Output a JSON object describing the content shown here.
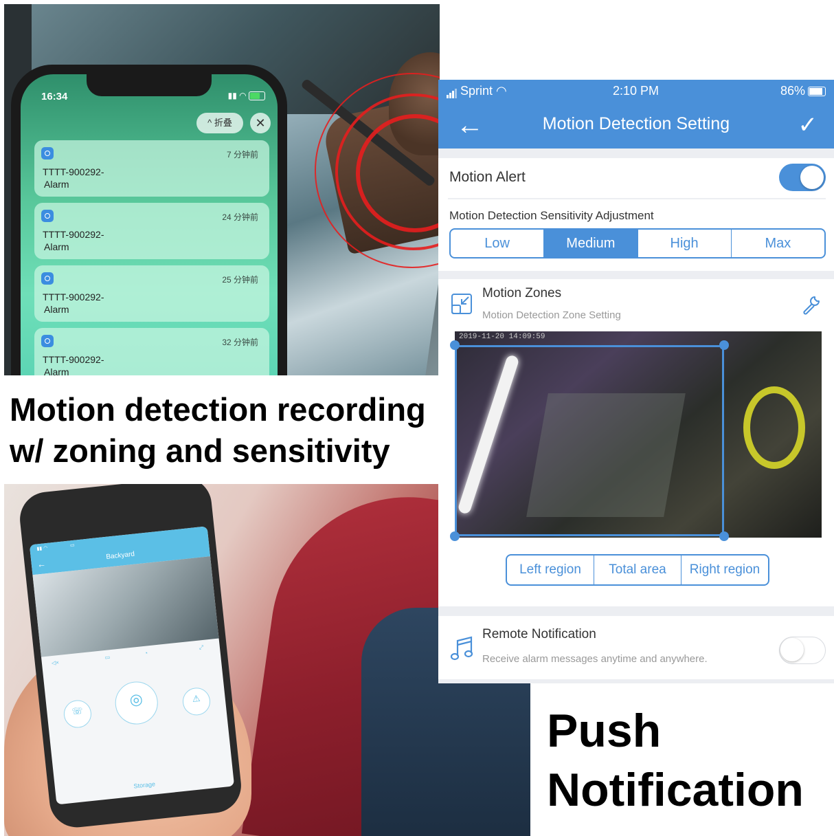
{
  "headline": {
    "line1": "Motion detection recording",
    "line2": "w/ zoning and sensitivity"
  },
  "push_notification": {
    "line1": "Push",
    "line2": "Notification"
  },
  "lock_screen": {
    "time": "16:34",
    "collapse_label": "折叠",
    "close_glyph": "✕",
    "notifications": [
      {
        "time": "7 分钟前",
        "title": "TTTT-900292-",
        "body": "Alarm"
      },
      {
        "time": "24 分钟前",
        "title": "TTTT-900292-",
        "body": "Alarm"
      },
      {
        "time": "25 分钟前",
        "title": "TTTT-900292-",
        "body": "Alarm"
      },
      {
        "time": "32 分钟前",
        "title": "TTTT-900292-",
        "body": "Alarm"
      }
    ]
  },
  "small_phone": {
    "title": "Backyard",
    "storage_label": "Storage"
  },
  "app": {
    "status": {
      "carrier": "Sprint",
      "time": "2:10 PM",
      "battery": "86%"
    },
    "header": {
      "title": "Motion Detection Setting",
      "back_glyph": "←",
      "confirm_glyph": "✓"
    },
    "motion_alert": {
      "label": "Motion Alert",
      "enabled": true
    },
    "sensitivity": {
      "label": "Motion Detection Sensitivity Adjustment",
      "options": [
        "Low",
        "Medium",
        "High",
        "Max"
      ],
      "selected": "Medium"
    },
    "motion_zones": {
      "title": "Motion Zones",
      "subtitle": "Motion Detection Zone Setting",
      "camera_timestamp": "2019-11-20 14:09:59"
    },
    "regions": [
      "Left region",
      "Total area",
      "Right region"
    ],
    "remote_notification": {
      "title": "Remote Notification",
      "subtitle": "Receive alarm messages anytime and anywhere.",
      "enabled": false
    },
    "accent_color": "#4a90d9"
  }
}
